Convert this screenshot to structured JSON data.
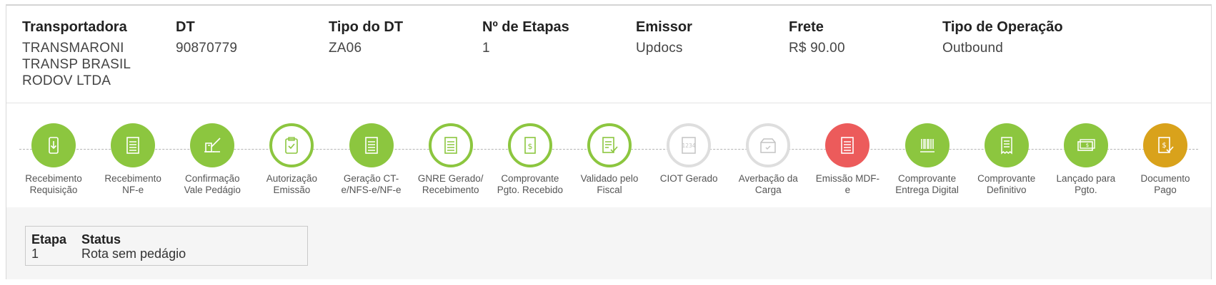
{
  "info": {
    "transportadora": {
      "label": "Transportadora",
      "lines": [
        "TRANSMARONI",
        "TRANSP BRASIL",
        "RODOV LTDA"
      ]
    },
    "dt": {
      "label": "DT",
      "value": "90870779"
    },
    "tipo_dt": {
      "label": "Tipo do DT",
      "value": "ZA06"
    },
    "etapas": {
      "label": "Nº de Etapas",
      "value": "1"
    },
    "emissor": {
      "label": "Emissor",
      "value": "Updocs"
    },
    "frete": {
      "label": "Frete",
      "value": "R$ 90.00"
    },
    "tipo_operacao": {
      "label": "Tipo de Operação",
      "value": "Outbound"
    }
  },
  "colors": {
    "green": "#8cc63f",
    "red": "#ec5b5b",
    "gold": "#d9a21b",
    "grey": "#dedede"
  },
  "steps": [
    {
      "line1": "Recebimento",
      "line2": "Requisição",
      "status": "done",
      "icon": "download-doc-icon"
    },
    {
      "line1": "Recebimento",
      "line2": "NF-e",
      "status": "done",
      "icon": "document-icon"
    },
    {
      "line1": "Confirmação",
      "line2": "Vale Pedágio",
      "status": "done",
      "icon": "toll-booth-icon"
    },
    {
      "line1": "Autorização",
      "line2": "Emissão",
      "status": "current",
      "icon": "clipboard-check-icon"
    },
    {
      "line1": "Geração CT-",
      "line2": "e/NFS-e/NF-e",
      "status": "done",
      "icon": "document-icon"
    },
    {
      "line1": "GNRE Gerado/",
      "line2": "Recebimento",
      "status": "current",
      "icon": "document-icon"
    },
    {
      "line1": "Comprovante",
      "line2": "Pgto. Recebido",
      "status": "current",
      "icon": "dollar-doc-icon"
    },
    {
      "line1": "Validado pelo",
      "line2": "Fiscal",
      "status": "current",
      "icon": "doc-check-icon"
    },
    {
      "line1": "CIOT Gerado",
      "line2": "",
      "status": "pending",
      "icon": "ciot-1234-icon"
    },
    {
      "line1": "Averbação da",
      "line2": "Carga",
      "status": "pending",
      "icon": "box-check-icon"
    },
    {
      "line1": "Emissão MDF-",
      "line2": "e",
      "status": "error",
      "icon": "document-icon"
    },
    {
      "line1": "Comprovante",
      "line2": "Entrega Digital",
      "status": "done",
      "icon": "barcode-icon"
    },
    {
      "line1": "Comprovante",
      "line2": "Definitivo",
      "status": "done",
      "icon": "receipt-icon"
    },
    {
      "line1": "Lançado para",
      "line2": "Pgto.",
      "status": "done",
      "icon": "banknote-icon"
    },
    {
      "line1": "Documento",
      "line2": "Pago",
      "status": "paid",
      "icon": "dollar-doc-check-icon"
    }
  ],
  "status_table": {
    "headers": {
      "etapa": "Etapa",
      "status": "Status"
    },
    "rows": [
      {
        "etapa": "1",
        "status": "Rota sem pedágio"
      }
    ]
  }
}
